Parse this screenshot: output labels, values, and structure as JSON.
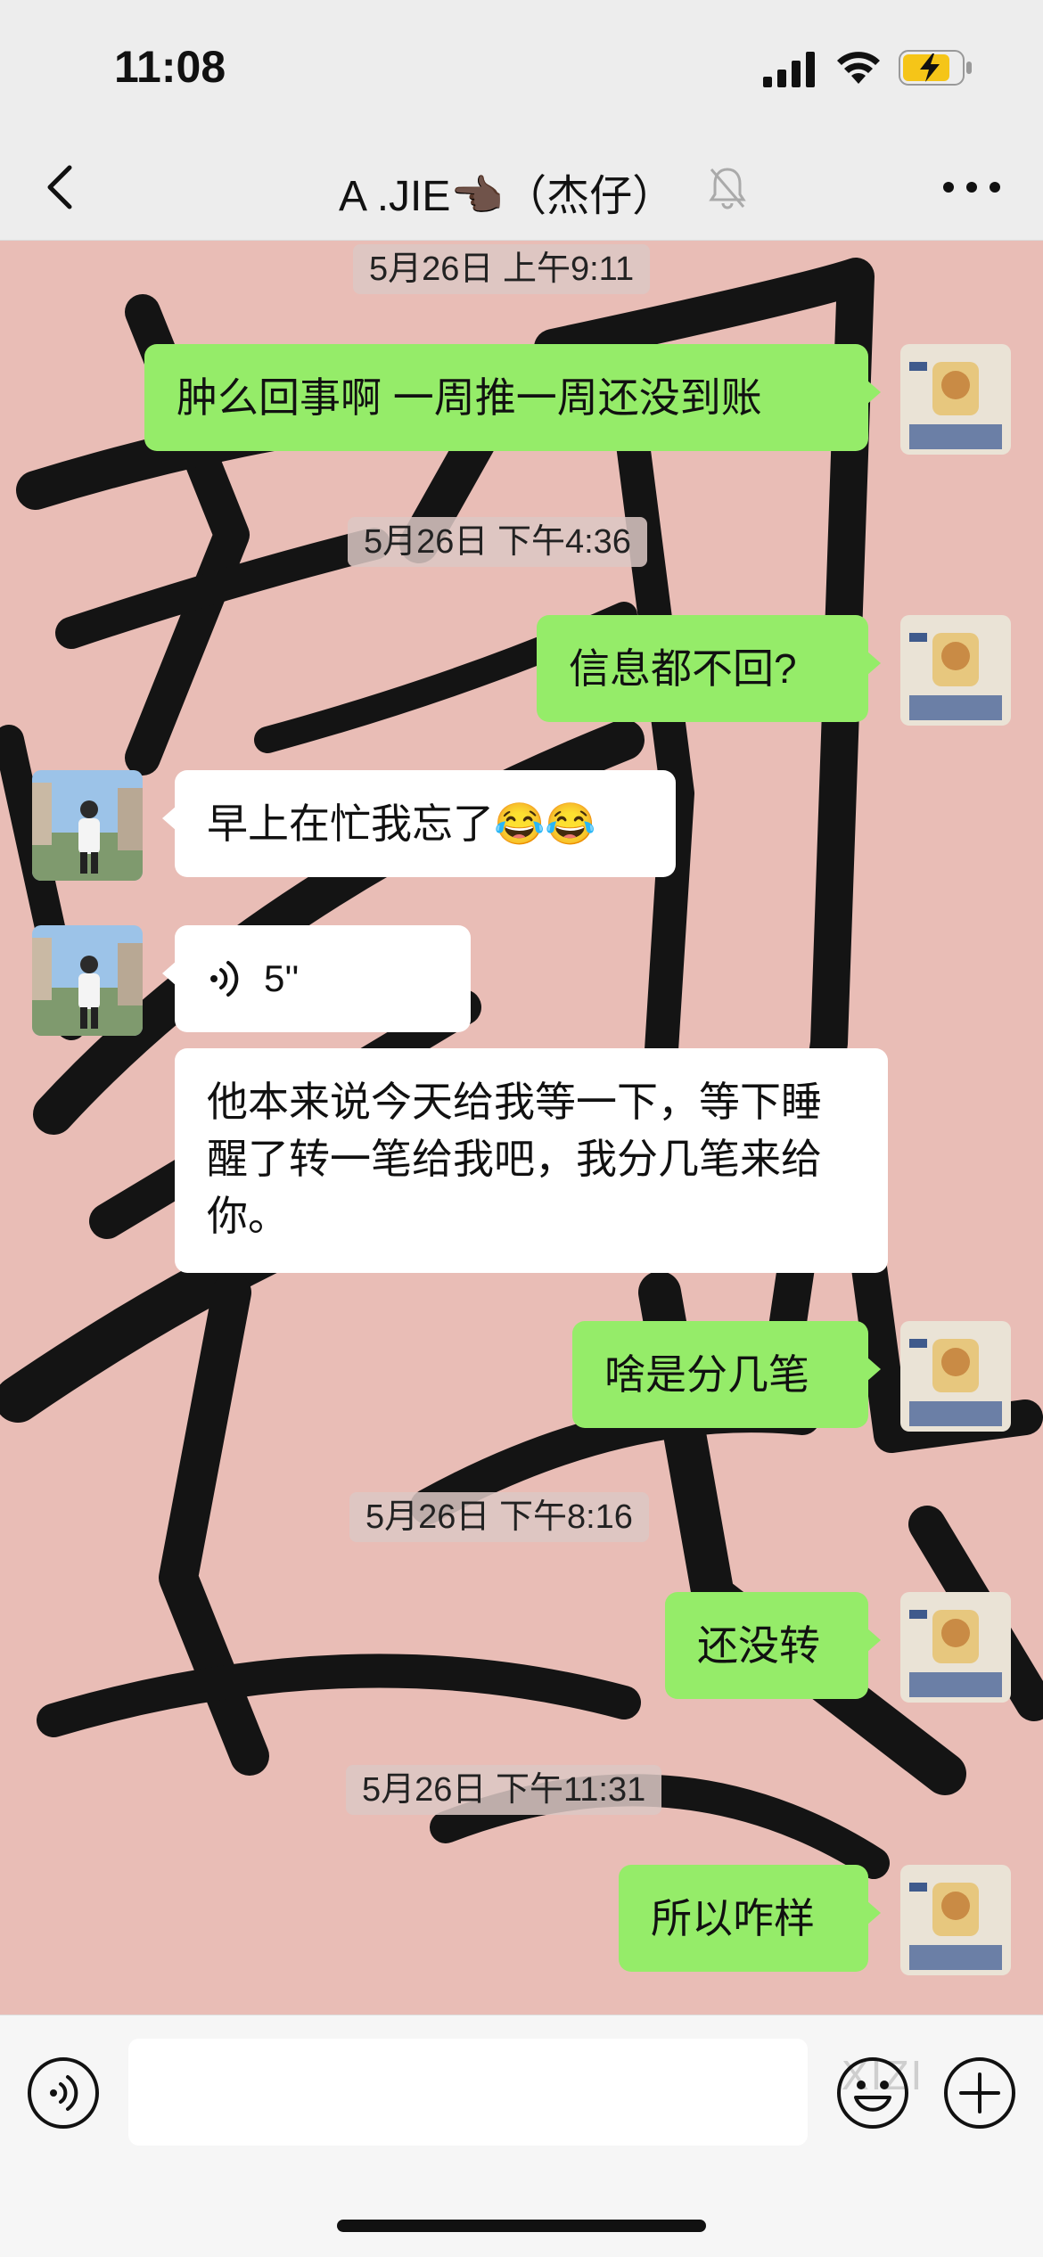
{
  "status_bar": {
    "time": "11:08"
  },
  "nav": {
    "title": "A .JIE👈🏿（杰仔）",
    "back_icon": "chevron-left-icon",
    "mute_icon": "bell-muted-icon",
    "more_icon": "ellipsis-icon"
  },
  "messages": [
    {
      "kind": "timestamp",
      "text": "5月26日 上午9:11"
    },
    {
      "kind": "sent",
      "text": "肿么回事啊 一周推一周还没到账"
    },
    {
      "kind": "timestamp",
      "text": "5月26日 下午4:36"
    },
    {
      "kind": "sent",
      "text": "信息都不回?"
    },
    {
      "kind": "received",
      "text": "早上在忙我忘了😂😂"
    },
    {
      "kind": "received-voice",
      "duration": "5''"
    },
    {
      "kind": "received",
      "text": "他本来说今天给我等一下，等下睡醒了转一笔给我吧，我分几笔来给你。"
    },
    {
      "kind": "sent",
      "text": "啥是分几笔"
    },
    {
      "kind": "timestamp",
      "text": "5月26日 下午8:16"
    },
    {
      "kind": "sent",
      "text": "还没转"
    },
    {
      "kind": "timestamp",
      "text": "5月26日 下午11:31"
    },
    {
      "kind": "sent",
      "text": "所以咋样"
    }
  ],
  "input_bar": {
    "voice_icon": "voice-mode-icon",
    "input_value": "",
    "emoji_icon": "emoji-icon",
    "plus_icon": "plus-circle-icon",
    "watermark": "XIZI"
  },
  "colors": {
    "sent_bubble": "#95ec69",
    "received_bubble": "#ffffff",
    "chat_background": "#e9bdb6",
    "bar_background": "#ededed"
  }
}
